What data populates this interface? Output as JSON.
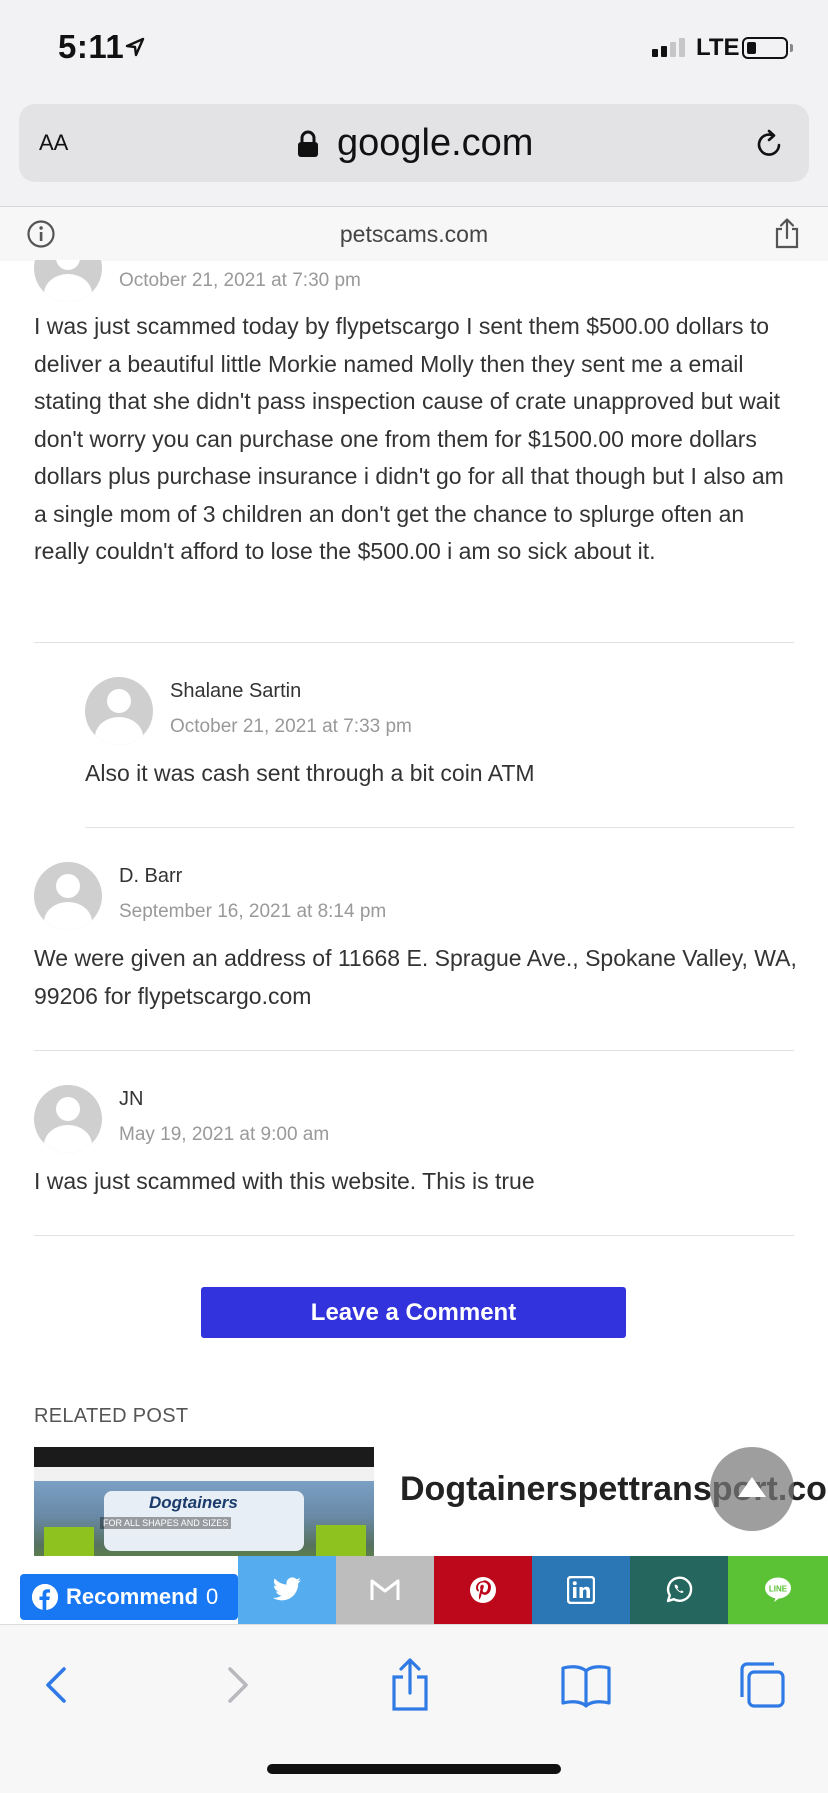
{
  "status": {
    "time": "5:11",
    "carrier": "LTE"
  },
  "browser": {
    "aa_label": "AA",
    "url": "google.com",
    "site_host": "petscams.com"
  },
  "comments": [
    {
      "date": "October 21, 2021 at 7:30 pm",
      "text": "I was just scammed today by flypetscargo I sent them $500.00 dollars to deliver a beautiful little Morkie named Molly then they sent me a email stating that she didn't pass inspection cause of crate unapproved but wait don't worry you can purchase one from them for $1500.00 more dollars dollars plus purchase insurance i didn't go for all that though but I also am a single mom of 3 children an don't get the chance to splurge often an really couldn't afford to lose the $500.00 i am so sick about it."
    },
    {
      "author": "Shalane Sartin",
      "date": "October 21, 2021 at 7:33 pm",
      "text": "Also it was cash sent through a bit coin ATM"
    },
    {
      "author": "D. Barr",
      "date": "September 16, 2021 at 8:14 pm",
      "text": "We were given an address of 11668 E. Sprague Ave., Spokane Valley, WA, 99206 for flypetscargo.com"
    },
    {
      "author": "JN",
      "date": "May 19, 2021 at 9:00 am",
      "text": "I was just scammed with this website. This is true"
    }
  ],
  "leave_comment_label": "Leave a Comment",
  "related": {
    "heading": "RELATED POST",
    "title": "Dogtainerspettransport.co",
    "thumb_logo": "Dogtainers",
    "thumb_tagline": "FOR ALL SHAPES AND SIZES"
  },
  "share": {
    "recommend_label": "Recommend",
    "recommend_count": "0",
    "buttons": [
      {
        "name": "twitter",
        "color": "#55acee"
      },
      {
        "name": "gmail",
        "color": "#bdbdbd"
      },
      {
        "name": "pinterest",
        "color": "#bd081c"
      },
      {
        "name": "linkedin",
        "color": "#2b77b5"
      },
      {
        "name": "whatsapp",
        "color": "#25675e"
      },
      {
        "name": "line",
        "color": "#5bc236"
      }
    ]
  },
  "colors": {
    "accent": "#3333dd",
    "facebook": "#1877f2",
    "ios_blue": "#2f7ae5"
  }
}
